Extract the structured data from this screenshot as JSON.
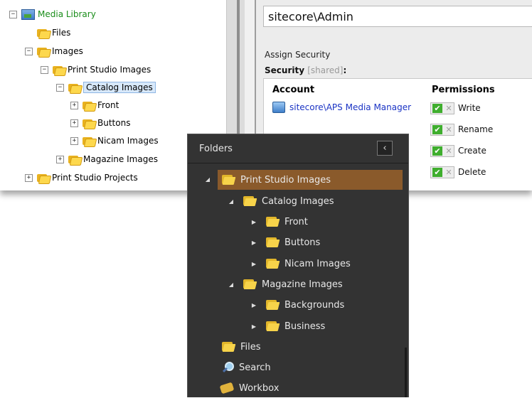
{
  "tree": {
    "root": "Media Library",
    "nodes": [
      {
        "label": "Files"
      },
      {
        "label": "Images"
      },
      {
        "label": "Print Studio Images"
      },
      {
        "label": "Catalog Images"
      },
      {
        "label": "Front"
      },
      {
        "label": "Buttons"
      },
      {
        "label": "Nicam Images"
      },
      {
        "label": "Magazine Images"
      },
      {
        "label": "Print Studio Projects"
      }
    ],
    "expander_expanded": "−",
    "expander_collapsed": "+"
  },
  "security": {
    "user": "sitecore\\Admin",
    "assign_title": "Assign Security",
    "label": "Security",
    "shared": "[shared]",
    "colon": ":",
    "account_header": "Account",
    "permissions_header": "Permissions",
    "account": "sitecore\\APS Media Manager",
    "permissions": [
      "Write",
      "Rename",
      "Create",
      "Delete"
    ],
    "check_glyph": "✔",
    "deny_glyph": "✕"
  },
  "folders_panel": {
    "title": "Folders",
    "collapse_glyph": "‹",
    "expanded_arrow": "◢",
    "collapsed_arrow": "▶",
    "items": [
      {
        "label": "Print Studio Images",
        "selected": true
      },
      {
        "label": "Catalog Images"
      },
      {
        "label": "Front"
      },
      {
        "label": "Buttons"
      },
      {
        "label": "Nicam Images"
      },
      {
        "label": "Magazine Images"
      },
      {
        "label": "Backgrounds"
      },
      {
        "label": "Business"
      },
      {
        "label": "Files"
      },
      {
        "label": "Search"
      },
      {
        "label": "Workbox"
      }
    ]
  },
  "colors": {
    "dark_panel": "#333333",
    "highlight": "#8a5a2b",
    "media_library_text": "#1a8d1a",
    "account_link": "#1a33c4",
    "check_green": "#3fae2e"
  }
}
